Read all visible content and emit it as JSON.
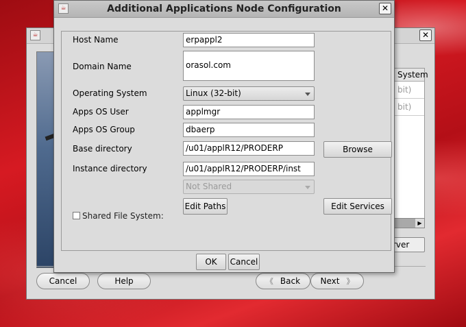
{
  "background_window": {
    "table_header": "System",
    "table_rows": [
      "bit)",
      "bit)"
    ],
    "server_button": "rver",
    "buttons": {
      "cancel": "Cancel",
      "help": "Help",
      "back": "Back",
      "next": "Next"
    }
  },
  "dialog": {
    "title": "Additional Applications Node Configuration",
    "fields": {
      "host_name": {
        "label": "Host Name",
        "value": "erpappl2"
      },
      "domain_name": {
        "label": "Domain Name",
        "value": "orasol.com"
      },
      "operating_system": {
        "label": "Operating System",
        "value": "Linux (32-bit)"
      },
      "apps_os_user": {
        "label": "Apps OS User",
        "value": "applmgr"
      },
      "apps_os_group": {
        "label": "Apps OS Group",
        "value": "dbaerp"
      },
      "base_directory": {
        "label": "Base directory",
        "value": "/u01/applR12/PRODERP"
      },
      "instance_directory": {
        "label": "Instance directory",
        "value": "/u01/applR12/PRODERP/inst"
      },
      "shared_file_system": {
        "label": "Shared File System:",
        "value": "Not Shared",
        "checked": false
      }
    },
    "buttons": {
      "browse": "Browse",
      "edit_paths": "Edit Paths",
      "edit_services": "Edit Services",
      "ok": "OK",
      "cancel": "Cancel"
    }
  }
}
